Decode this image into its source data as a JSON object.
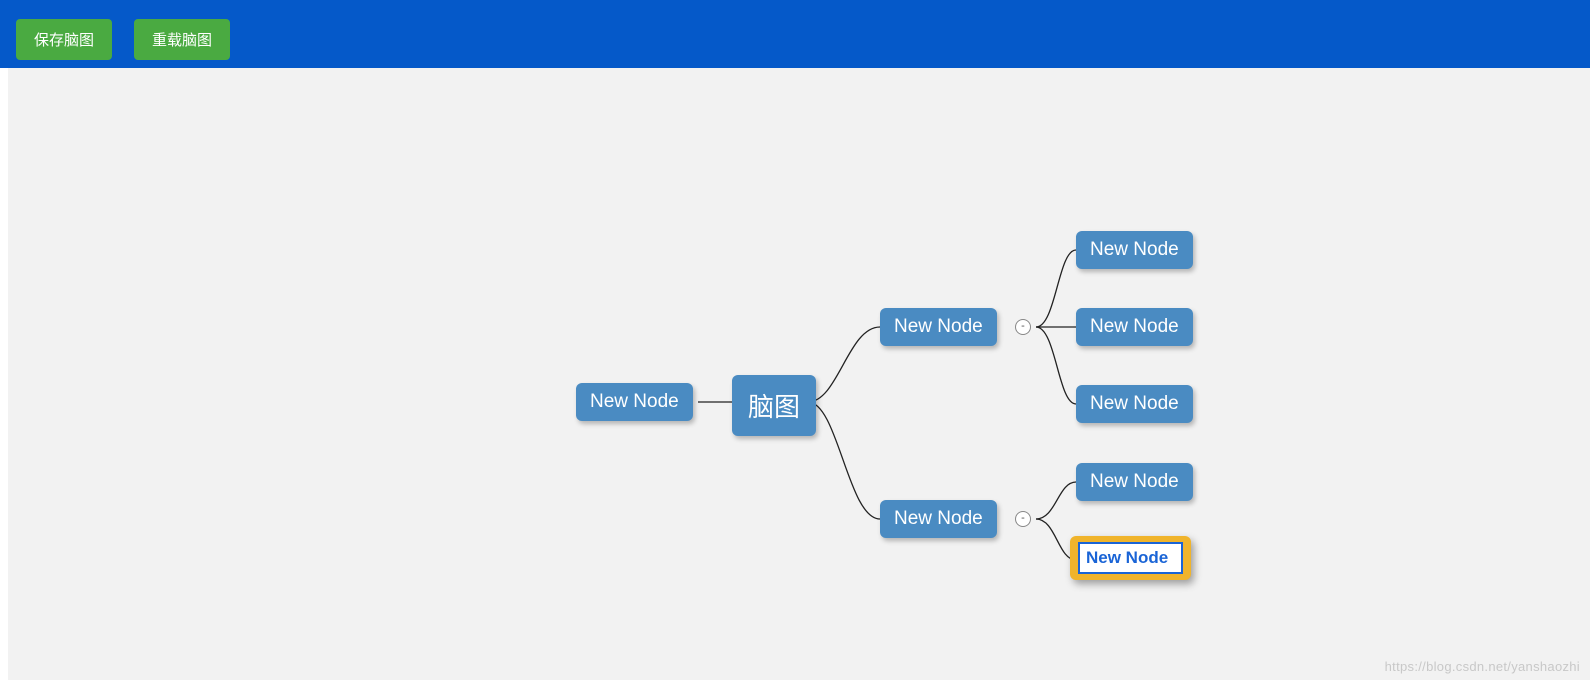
{
  "toolbar": {
    "save_label": "保存脑图",
    "reload_label": "重载脑图"
  },
  "mindmap": {
    "root": {
      "label": "脑图"
    },
    "left_child": {
      "label": "New Node"
    },
    "right_children": [
      {
        "label": "New Node",
        "collapse_symbol": "-",
        "children": [
          {
            "label": "New Node"
          },
          {
            "label": "New Node"
          },
          {
            "label": "New Node"
          }
        ]
      },
      {
        "label": "New Node",
        "collapse_symbol": "-",
        "children": [
          {
            "label": "New Node"
          },
          {
            "label": "New Node",
            "editing": true
          }
        ]
      }
    ]
  },
  "watermark": "https://blog.csdn.net/yanshaozhi",
  "colors": {
    "toolbar_bg": "#0559c9",
    "button_bg": "#4aaa41",
    "node_bg": "#4a8bc2",
    "editing_bg": "#f0b42c",
    "canvas_bg": "#f2f2f2"
  }
}
